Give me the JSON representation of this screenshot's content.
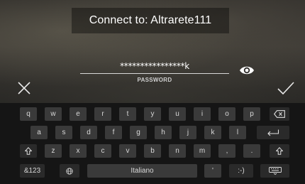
{
  "dialog": {
    "title": "Connect to: Altrarete111",
    "password_value": "****************k",
    "password_label": "PASSWORD"
  },
  "icons": {
    "show_password": "eye-icon",
    "cancel": "close-icon",
    "confirm": "checkmark-icon"
  },
  "keyboard": {
    "row1": [
      "q",
      "w",
      "e",
      "r",
      "t",
      "y",
      "u",
      "i",
      "o",
      "p"
    ],
    "row2": [
      "a",
      "s",
      "d",
      "f",
      "g",
      "h",
      "j",
      "k",
      "l"
    ],
    "row3": [
      "z",
      "x",
      "c",
      "v",
      "b",
      "n",
      "m",
      ",",
      "."
    ],
    "symbols_label": "&123",
    "space_label": "Italiano",
    "apostrophe_label": "'",
    "emoticon_label": ":-)"
  }
}
